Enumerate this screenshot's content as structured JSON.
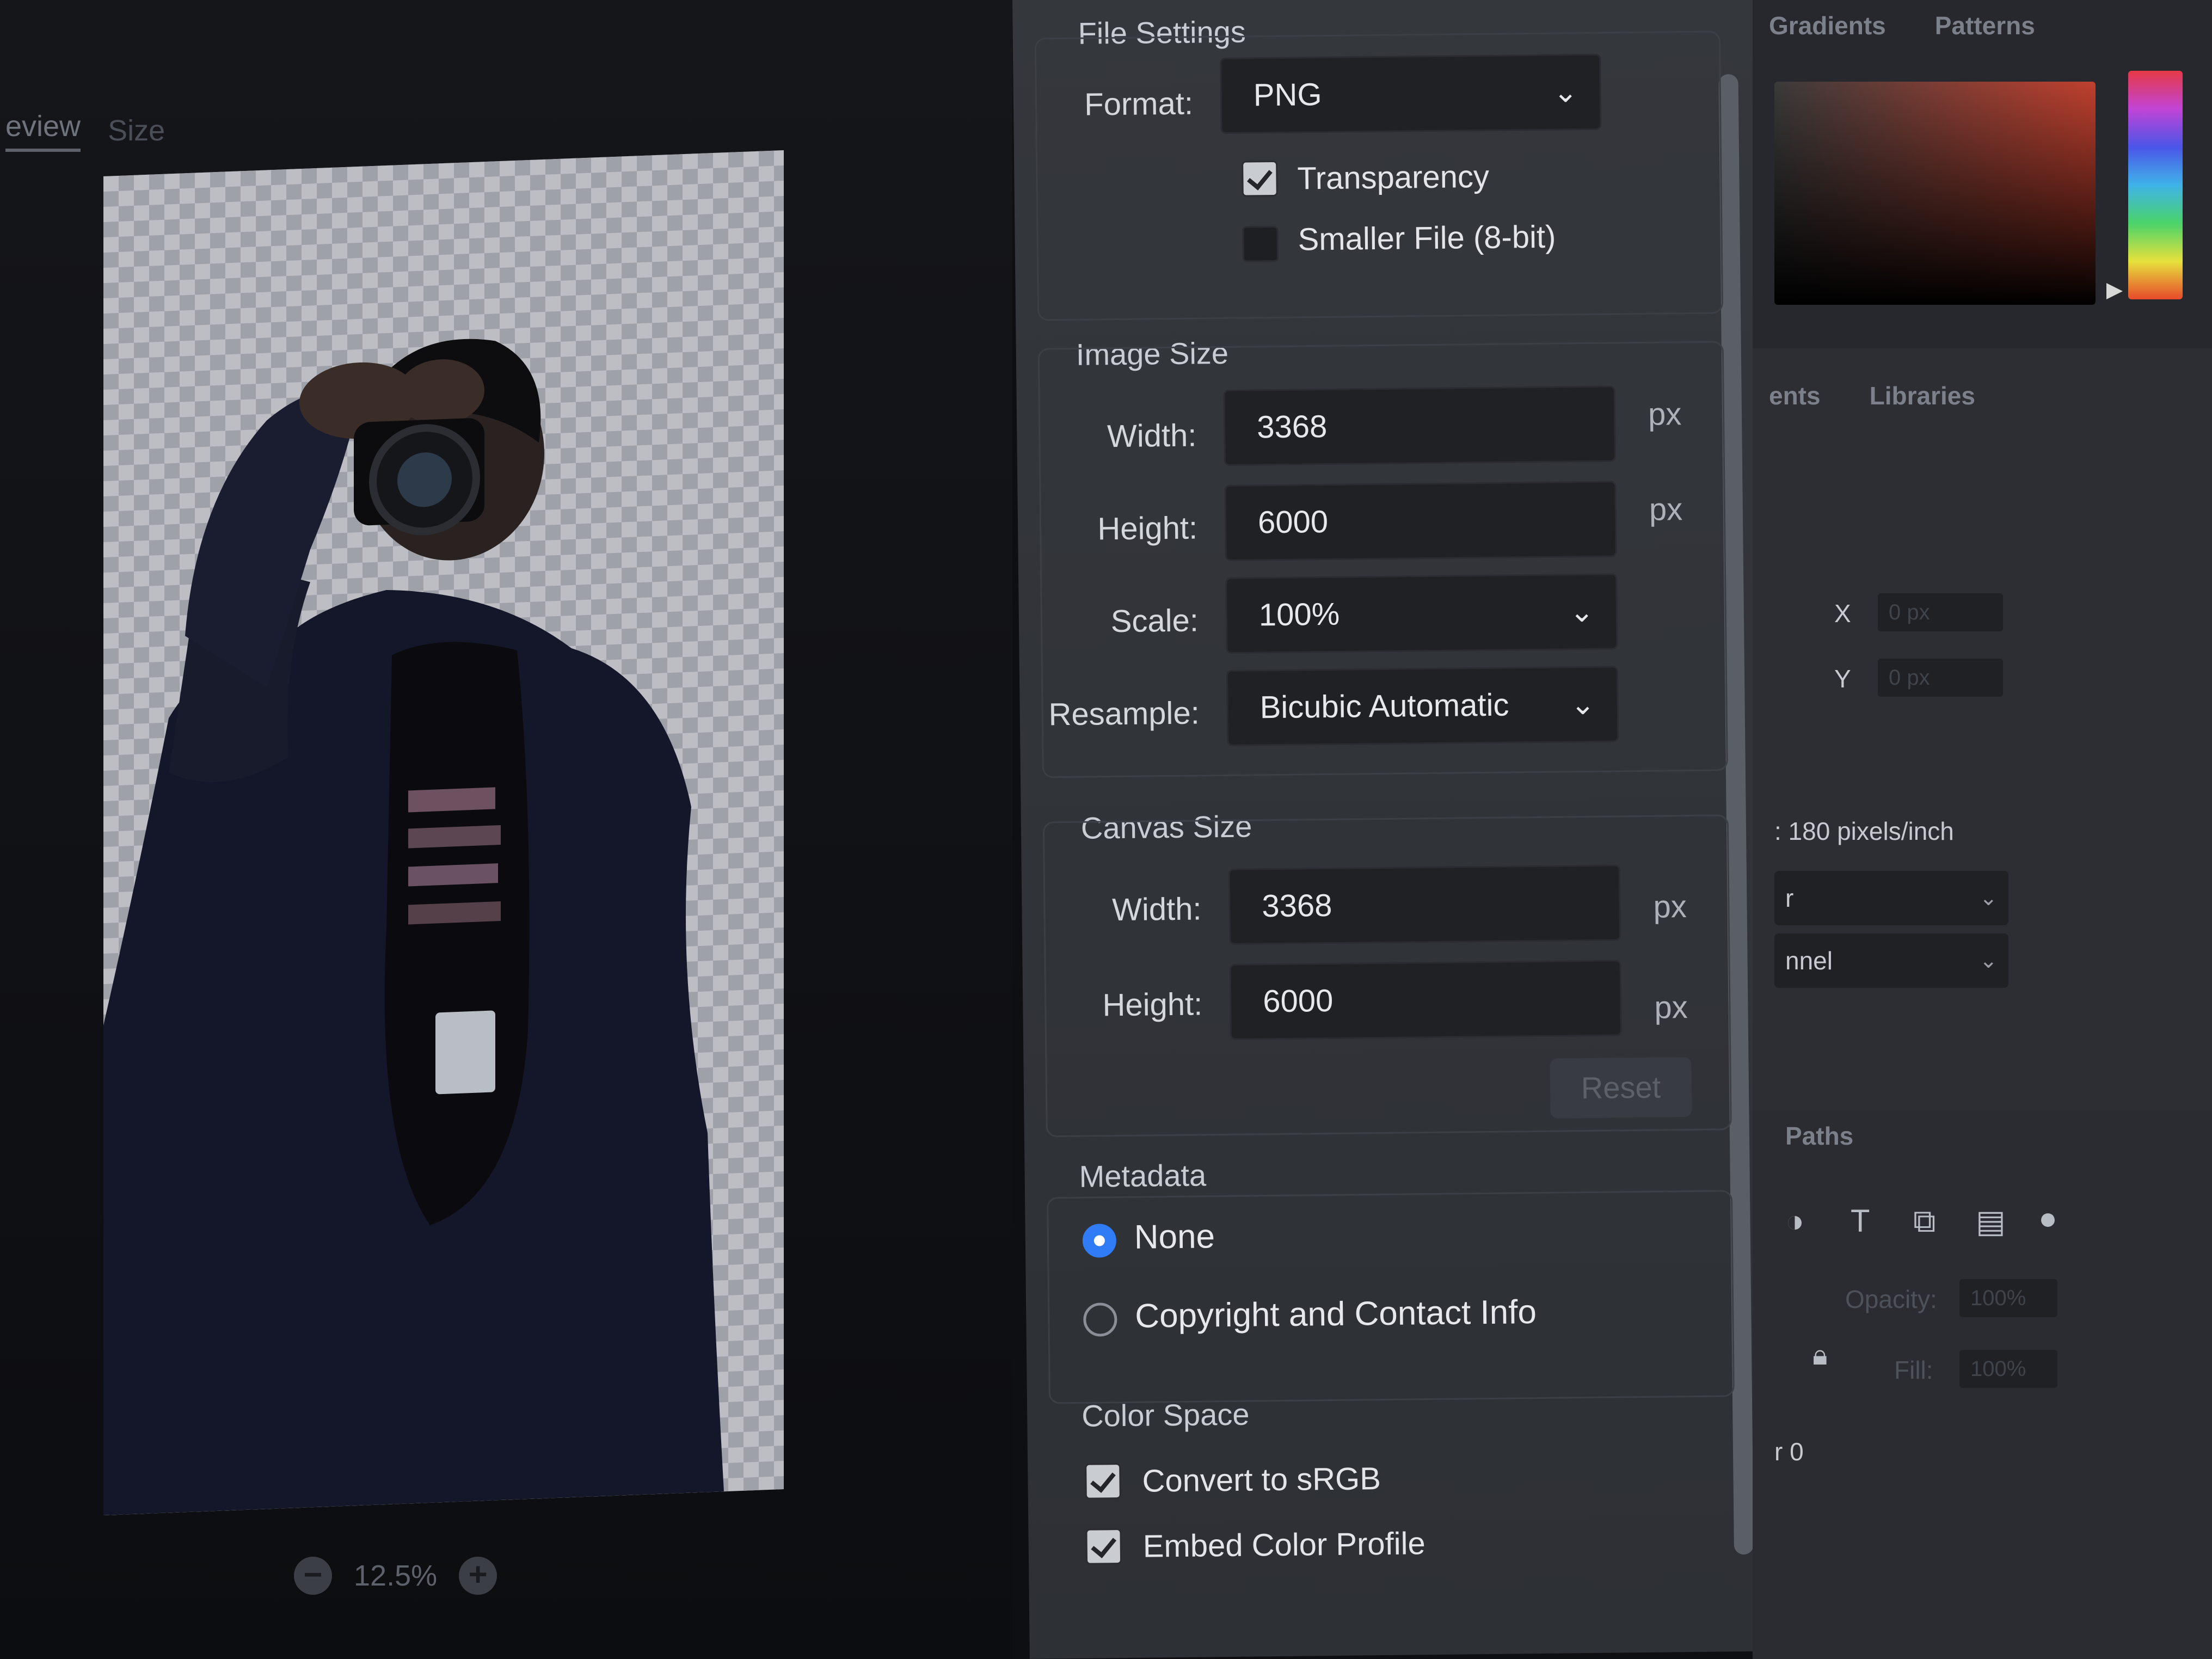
{
  "preview": {
    "tabs": [
      "eview",
      "Size"
    ],
    "zoom": "12.5%",
    "zoom_out": "−",
    "zoom_in": "+"
  },
  "file_settings": {
    "title": "File Settings",
    "format_label": "Format:",
    "format_value": "PNG",
    "transparency_label": "Transparency",
    "transparency_checked": true,
    "smaller_file_label": "Smaller File (8-bit)",
    "smaller_file_checked": false
  },
  "image_size": {
    "title": "Image Size",
    "width_label": "Width:",
    "width_value": "3368",
    "height_label": "Height:",
    "height_value": "6000",
    "unit": "px",
    "scale_label": "Scale:",
    "scale_value": "100%",
    "resample_label": "Resample:",
    "resample_value": "Bicubic Automatic"
  },
  "canvas_size": {
    "title": "Canvas Size",
    "width_label": "Width:",
    "width_value": "3368",
    "height_label": "Height:",
    "height_value": "6000",
    "unit": "px",
    "reset_label": "Reset"
  },
  "metadata": {
    "title": "Metadata",
    "options": [
      {
        "label": "None",
        "selected": true
      },
      {
        "label": "Copyright and Contact Info",
        "selected": false
      }
    ]
  },
  "color_space": {
    "title": "Color Space",
    "convert_label": "Convert to sRGB",
    "convert_checked": true,
    "embed_label": "Embed Color Profile",
    "embed_checked": true
  },
  "right_panels": {
    "tabs": [
      "Gradients",
      "Patterns"
    ],
    "tabs2": [
      "ents",
      "Libraries"
    ],
    "x_label": "X",
    "x_value": "0 px",
    "y_label": "Y",
    "y_value": "0 px",
    "resolution": ": 180 pixels/inch",
    "select1": "r",
    "select2": "nnel",
    "paths_tab": "Paths",
    "opacity_label": "Opacity:",
    "opacity_value": "100%",
    "fill_label": "Fill:",
    "fill_value": "100%",
    "layer_name": "r 0"
  }
}
